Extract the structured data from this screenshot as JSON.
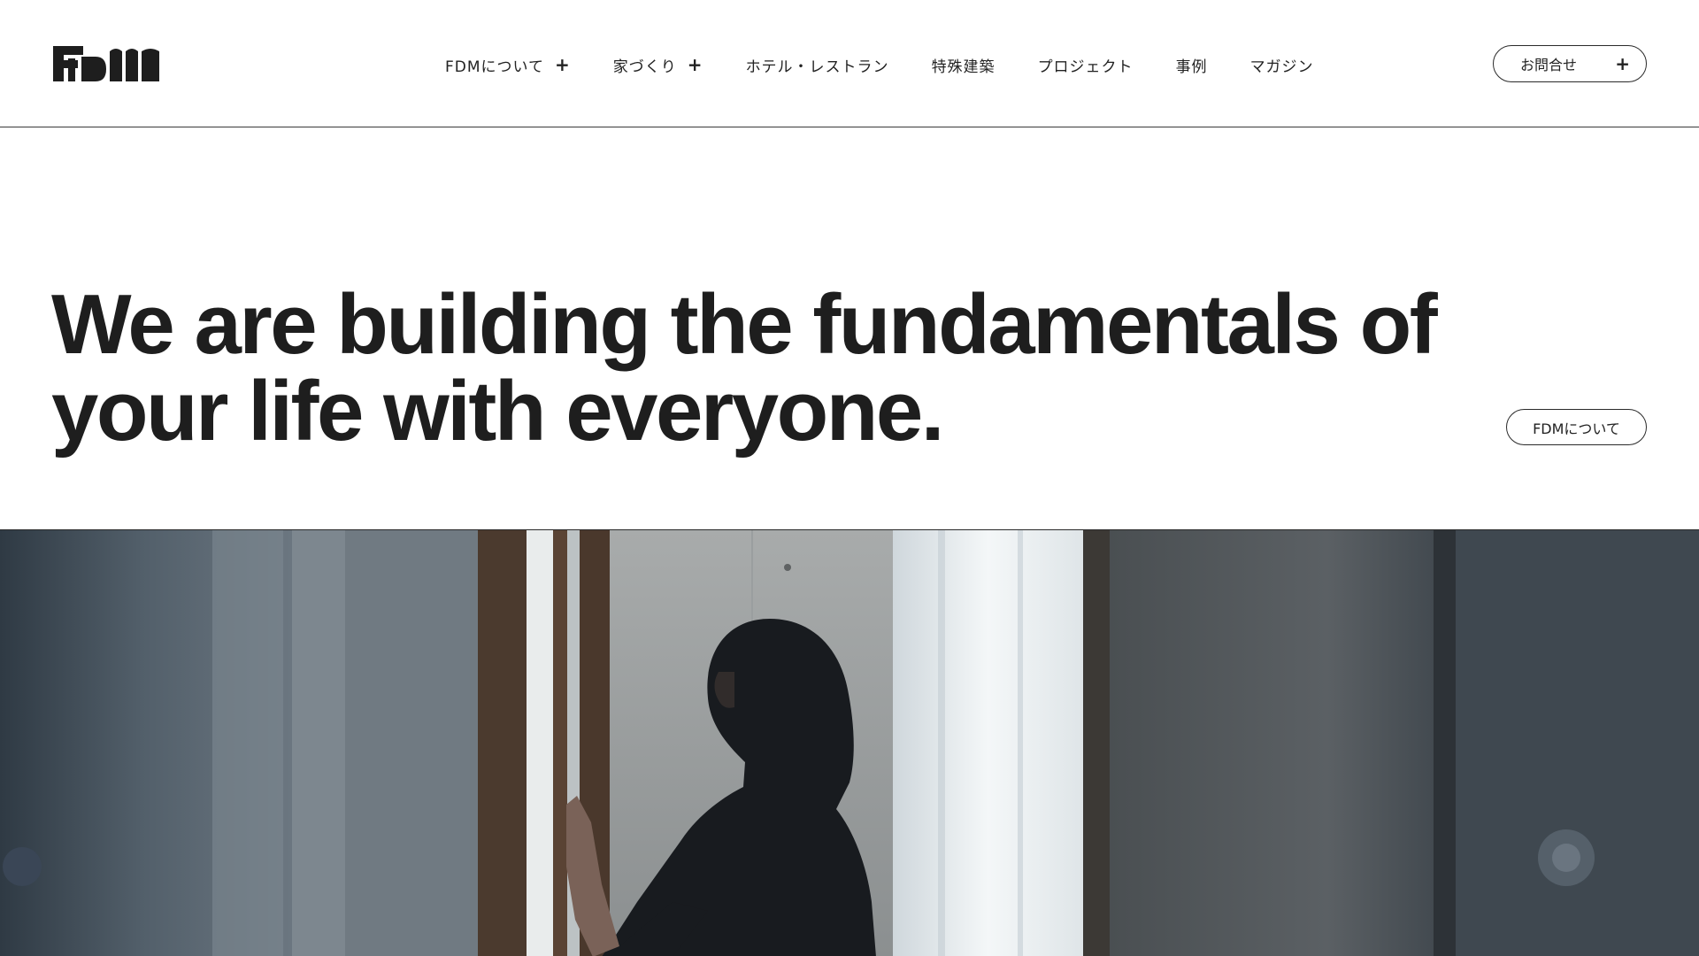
{
  "header": {
    "logo_text": "FDM",
    "nav": [
      {
        "label": "FDMについて",
        "has_submenu": true
      },
      {
        "label": "家づくり",
        "has_submenu": true
      },
      {
        "label": "ホテル・レストラン",
        "has_submenu": false
      },
      {
        "label": "特殊建築",
        "has_submenu": false
      },
      {
        "label": "プロジェクト",
        "has_submenu": false
      },
      {
        "label": "事例",
        "has_submenu": false
      },
      {
        "label": "マガジン",
        "has_submenu": false
      }
    ],
    "plus_symbol": "+",
    "contact_label": "お問合せ"
  },
  "hero": {
    "line1": "We are building the fundamentals of",
    "line2": "your life with everyone.",
    "about_button": "FDMについて"
  },
  "colors": {
    "text": "#1e1e1e",
    "background": "#ffffff",
    "border": "#2a2a2a"
  }
}
